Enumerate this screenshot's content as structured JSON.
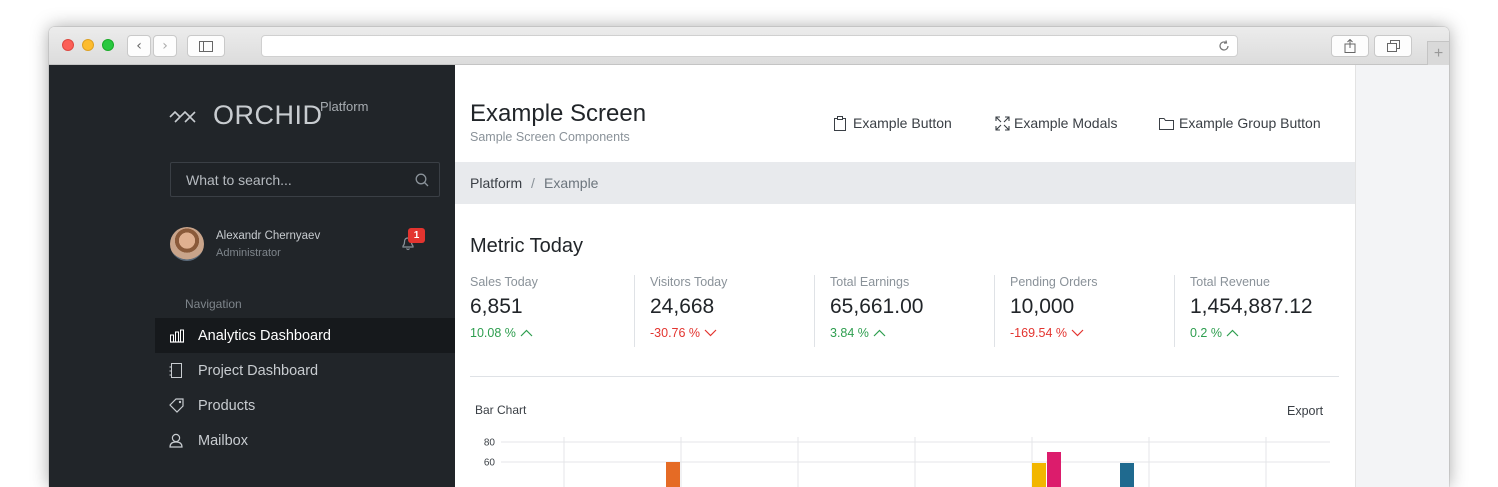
{
  "sidebar": {
    "logo_text": "ORCHID",
    "logo_sup": "Platform",
    "search_placeholder": "What to search...",
    "user": {
      "name": "Alexandr Chernyaev",
      "role": "Administrator",
      "notifications": "1"
    },
    "nav_heading": "Navigation",
    "items": [
      {
        "label": "Analytics Dashboard",
        "icon": "bar-chart-icon",
        "active": true
      },
      {
        "label": "Project Dashboard",
        "icon": "notebook-icon",
        "active": false
      },
      {
        "label": "Products",
        "icon": "tag-icon",
        "active": false
      },
      {
        "label": "Mailbox",
        "icon": "user-icon",
        "active": false
      }
    ]
  },
  "header": {
    "title": "Example Screen",
    "subtitle": "Sample Screen Components",
    "commands": [
      {
        "label": "Example Button",
        "icon": "clipboard-icon"
      },
      {
        "label": "Example Modals",
        "icon": "expand-icon"
      },
      {
        "label": "Example Group Button",
        "icon": "folder-icon"
      }
    ]
  },
  "breadcrumb": {
    "items": [
      "Platform",
      "Example"
    ],
    "separator": "/"
  },
  "metrics": {
    "title": "Metric Today",
    "items": [
      {
        "label": "Sales Today",
        "value": "6,851",
        "change": "10.08 %",
        "direction": "up"
      },
      {
        "label": "Visitors Today",
        "value": "24,668",
        "change": "-30.76 %",
        "direction": "down"
      },
      {
        "label": "Total Earnings",
        "value": "65,661.00",
        "change": "3.84 %",
        "direction": "up"
      },
      {
        "label": "Pending Orders",
        "value": "10,000",
        "change": "-169.54 %",
        "direction": "down"
      },
      {
        "label": "Total Revenue",
        "value": "1,454,887.12",
        "change": "0.2 %",
        "direction": "up"
      }
    ]
  },
  "chart_section": {
    "title": "Bar Chart",
    "export_label": "Export"
  },
  "chart_data": {
    "type": "bar",
    "title": "Bar Chart",
    "yticks": [
      "80",
      "60"
    ],
    "ylim": [
      0,
      80
    ],
    "bars": [
      {
        "group": 2,
        "value": 60,
        "color": "#e56b25"
      },
      {
        "group": 5,
        "value": 59,
        "color": "#f2b600"
      },
      {
        "group": 5,
        "value": 70,
        "color": "#dc1c6c"
      },
      {
        "group": 6,
        "value": 59,
        "color": "#1f6a8f"
      }
    ],
    "groups": 7
  },
  "colors": {
    "sidebar_bg": "#212529",
    "up": "#2e9e4f",
    "down": "#e3342f",
    "badge": "#e3342f"
  }
}
